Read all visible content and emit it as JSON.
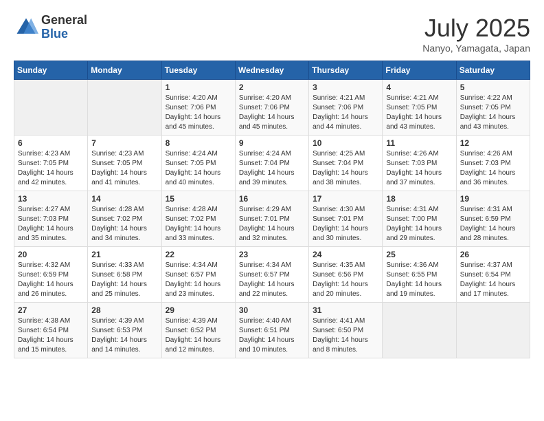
{
  "logo": {
    "general": "General",
    "blue": "Blue"
  },
  "title": "July 2025",
  "location": "Nanyo, Yamagata, Japan",
  "headers": [
    "Sunday",
    "Monday",
    "Tuesday",
    "Wednesday",
    "Thursday",
    "Friday",
    "Saturday"
  ],
  "weeks": [
    [
      {
        "day": "",
        "info": ""
      },
      {
        "day": "",
        "info": ""
      },
      {
        "day": "1",
        "info": "Sunrise: 4:20 AM\nSunset: 7:06 PM\nDaylight: 14 hours and 45 minutes."
      },
      {
        "day": "2",
        "info": "Sunrise: 4:20 AM\nSunset: 7:06 PM\nDaylight: 14 hours and 45 minutes."
      },
      {
        "day": "3",
        "info": "Sunrise: 4:21 AM\nSunset: 7:06 PM\nDaylight: 14 hours and 44 minutes."
      },
      {
        "day": "4",
        "info": "Sunrise: 4:21 AM\nSunset: 7:05 PM\nDaylight: 14 hours and 43 minutes."
      },
      {
        "day": "5",
        "info": "Sunrise: 4:22 AM\nSunset: 7:05 PM\nDaylight: 14 hours and 43 minutes."
      }
    ],
    [
      {
        "day": "6",
        "info": "Sunrise: 4:23 AM\nSunset: 7:05 PM\nDaylight: 14 hours and 42 minutes."
      },
      {
        "day": "7",
        "info": "Sunrise: 4:23 AM\nSunset: 7:05 PM\nDaylight: 14 hours and 41 minutes."
      },
      {
        "day": "8",
        "info": "Sunrise: 4:24 AM\nSunset: 7:05 PM\nDaylight: 14 hours and 40 minutes."
      },
      {
        "day": "9",
        "info": "Sunrise: 4:24 AM\nSunset: 7:04 PM\nDaylight: 14 hours and 39 minutes."
      },
      {
        "day": "10",
        "info": "Sunrise: 4:25 AM\nSunset: 7:04 PM\nDaylight: 14 hours and 38 minutes."
      },
      {
        "day": "11",
        "info": "Sunrise: 4:26 AM\nSunset: 7:03 PM\nDaylight: 14 hours and 37 minutes."
      },
      {
        "day": "12",
        "info": "Sunrise: 4:26 AM\nSunset: 7:03 PM\nDaylight: 14 hours and 36 minutes."
      }
    ],
    [
      {
        "day": "13",
        "info": "Sunrise: 4:27 AM\nSunset: 7:03 PM\nDaylight: 14 hours and 35 minutes."
      },
      {
        "day": "14",
        "info": "Sunrise: 4:28 AM\nSunset: 7:02 PM\nDaylight: 14 hours and 34 minutes."
      },
      {
        "day": "15",
        "info": "Sunrise: 4:28 AM\nSunset: 7:02 PM\nDaylight: 14 hours and 33 minutes."
      },
      {
        "day": "16",
        "info": "Sunrise: 4:29 AM\nSunset: 7:01 PM\nDaylight: 14 hours and 32 minutes."
      },
      {
        "day": "17",
        "info": "Sunrise: 4:30 AM\nSunset: 7:01 PM\nDaylight: 14 hours and 30 minutes."
      },
      {
        "day": "18",
        "info": "Sunrise: 4:31 AM\nSunset: 7:00 PM\nDaylight: 14 hours and 29 minutes."
      },
      {
        "day": "19",
        "info": "Sunrise: 4:31 AM\nSunset: 6:59 PM\nDaylight: 14 hours and 28 minutes."
      }
    ],
    [
      {
        "day": "20",
        "info": "Sunrise: 4:32 AM\nSunset: 6:59 PM\nDaylight: 14 hours and 26 minutes."
      },
      {
        "day": "21",
        "info": "Sunrise: 4:33 AM\nSunset: 6:58 PM\nDaylight: 14 hours and 25 minutes."
      },
      {
        "day": "22",
        "info": "Sunrise: 4:34 AM\nSunset: 6:57 PM\nDaylight: 14 hours and 23 minutes."
      },
      {
        "day": "23",
        "info": "Sunrise: 4:34 AM\nSunset: 6:57 PM\nDaylight: 14 hours and 22 minutes."
      },
      {
        "day": "24",
        "info": "Sunrise: 4:35 AM\nSunset: 6:56 PM\nDaylight: 14 hours and 20 minutes."
      },
      {
        "day": "25",
        "info": "Sunrise: 4:36 AM\nSunset: 6:55 PM\nDaylight: 14 hours and 19 minutes."
      },
      {
        "day": "26",
        "info": "Sunrise: 4:37 AM\nSunset: 6:54 PM\nDaylight: 14 hours and 17 minutes."
      }
    ],
    [
      {
        "day": "27",
        "info": "Sunrise: 4:38 AM\nSunset: 6:54 PM\nDaylight: 14 hours and 15 minutes."
      },
      {
        "day": "28",
        "info": "Sunrise: 4:39 AM\nSunset: 6:53 PM\nDaylight: 14 hours and 14 minutes."
      },
      {
        "day": "29",
        "info": "Sunrise: 4:39 AM\nSunset: 6:52 PM\nDaylight: 14 hours and 12 minutes."
      },
      {
        "day": "30",
        "info": "Sunrise: 4:40 AM\nSunset: 6:51 PM\nDaylight: 14 hours and 10 minutes."
      },
      {
        "day": "31",
        "info": "Sunrise: 4:41 AM\nSunset: 6:50 PM\nDaylight: 14 hours and 8 minutes."
      },
      {
        "day": "",
        "info": ""
      },
      {
        "day": "",
        "info": ""
      }
    ]
  ]
}
